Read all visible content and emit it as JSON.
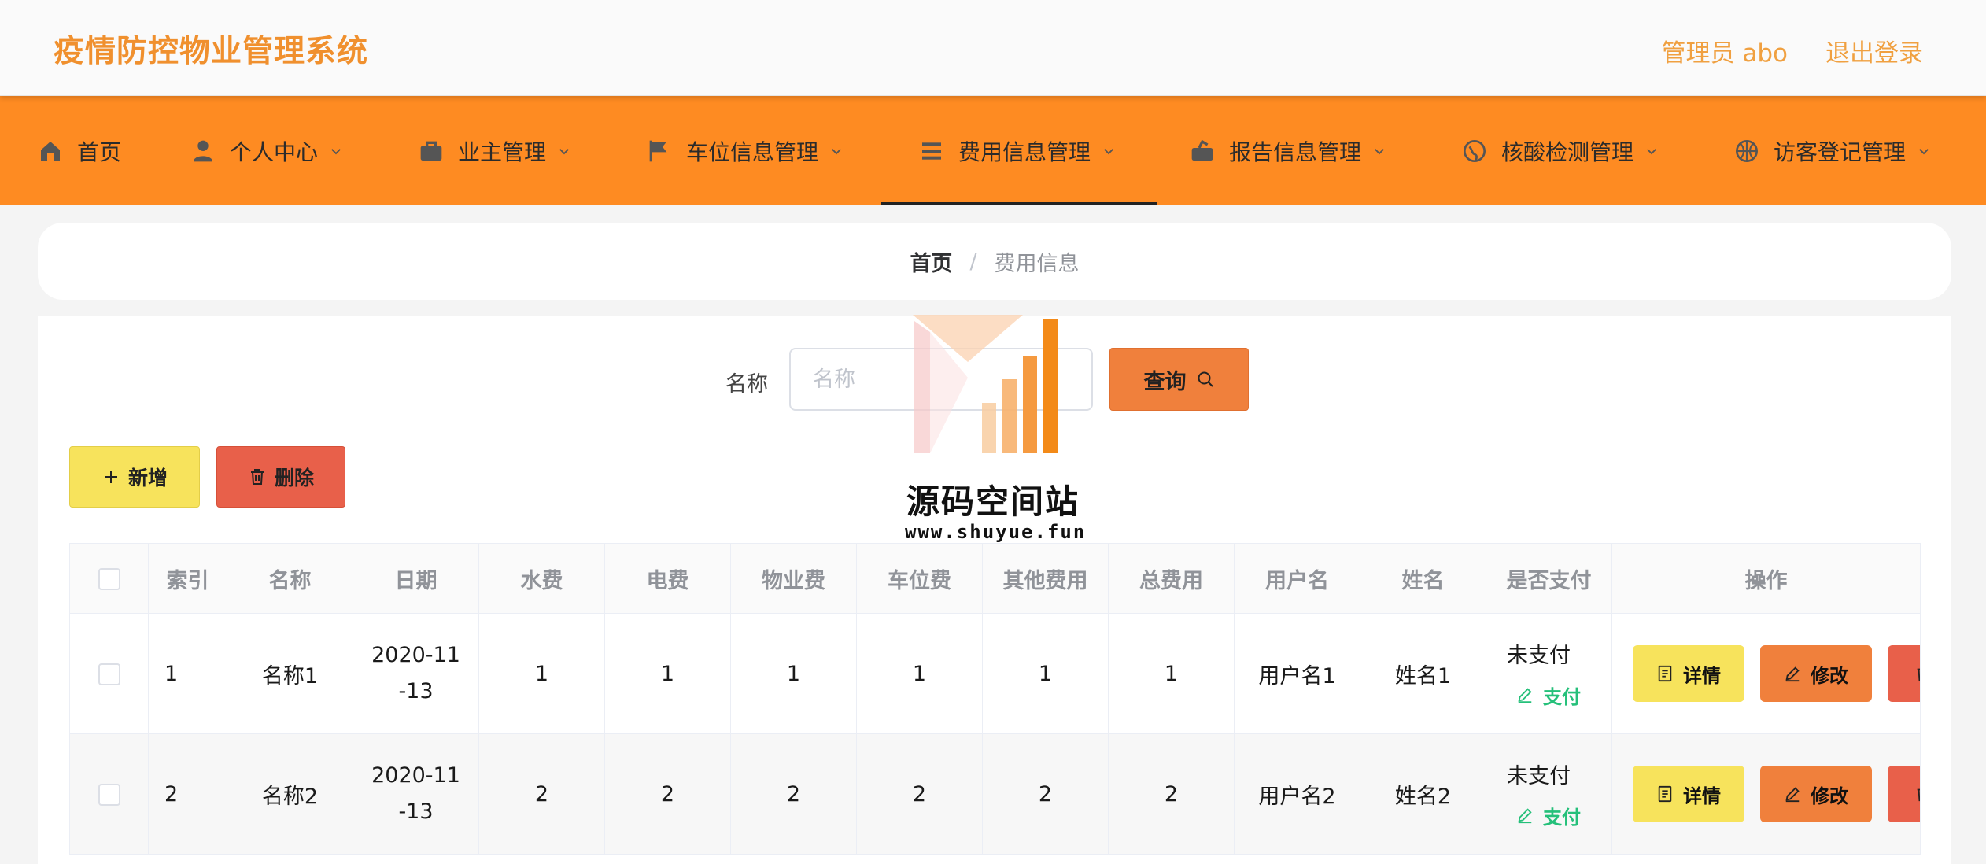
{
  "header": {
    "title": "疫情防控物业管理系统",
    "user_label": "管理员 abo",
    "logout_label": "退出登录"
  },
  "nav": {
    "items": [
      {
        "label": "首页",
        "icon": "home-icon"
      },
      {
        "label": "个人中心",
        "icon": "person-icon"
      },
      {
        "label": "业主管理",
        "icon": "briefcase-icon"
      },
      {
        "label": "车位信息管理",
        "icon": "flag-icon"
      },
      {
        "label": "费用信息管理",
        "icon": "list-icon",
        "active": true
      },
      {
        "label": "报告信息管理",
        "icon": "bag-icon"
      },
      {
        "label": "核酸检测管理",
        "icon": "globe-icon"
      },
      {
        "label": "访客登记管理",
        "icon": "basketball-icon"
      }
    ]
  },
  "breadcrumb": {
    "home": "首页",
    "separator": "/",
    "current": "费用信息"
  },
  "search": {
    "label": "名称",
    "placeholder": "名称",
    "button_label": "查询"
  },
  "actions": {
    "add_label": "新增",
    "delete_label": "删除"
  },
  "watermark": {
    "title": "源码空间站",
    "url": "www.shuyue.fun"
  },
  "table": {
    "columns": [
      "索引",
      "名称",
      "日期",
      "水费",
      "电费",
      "物业费",
      "车位费",
      "其他费用",
      "总费用",
      "用户名",
      "姓名",
      "是否支付",
      "操作"
    ],
    "rows": [
      {
        "index": "1",
        "name": "名称1",
        "date_1": "2020-11",
        "date_2": "-13",
        "water": "1",
        "electric": "1",
        "property": "1",
        "parking": "1",
        "other": "1",
        "total": "1",
        "username": "用户名1",
        "realname": "姓名1",
        "paid": "未支付",
        "pay_action": "支付"
      },
      {
        "index": "2",
        "name": "名称2",
        "date_1": "2020-11",
        "date_2": "-13",
        "water": "2",
        "electric": "2",
        "property": "2",
        "parking": "2",
        "other": "2",
        "total": "2",
        "username": "用户名2",
        "realname": "姓名2",
        "paid": "未支付",
        "pay_action": "支付"
      }
    ],
    "detail_label": "详情",
    "edit_label": "修改"
  },
  "colors": {
    "brand": "#f0902e",
    "nav_bg": "#fe8b22",
    "query_btn": "#f0803c",
    "add_btn": "#f7e35c",
    "delete_btn": "#e8604a",
    "pay_link": "#25c07a"
  }
}
